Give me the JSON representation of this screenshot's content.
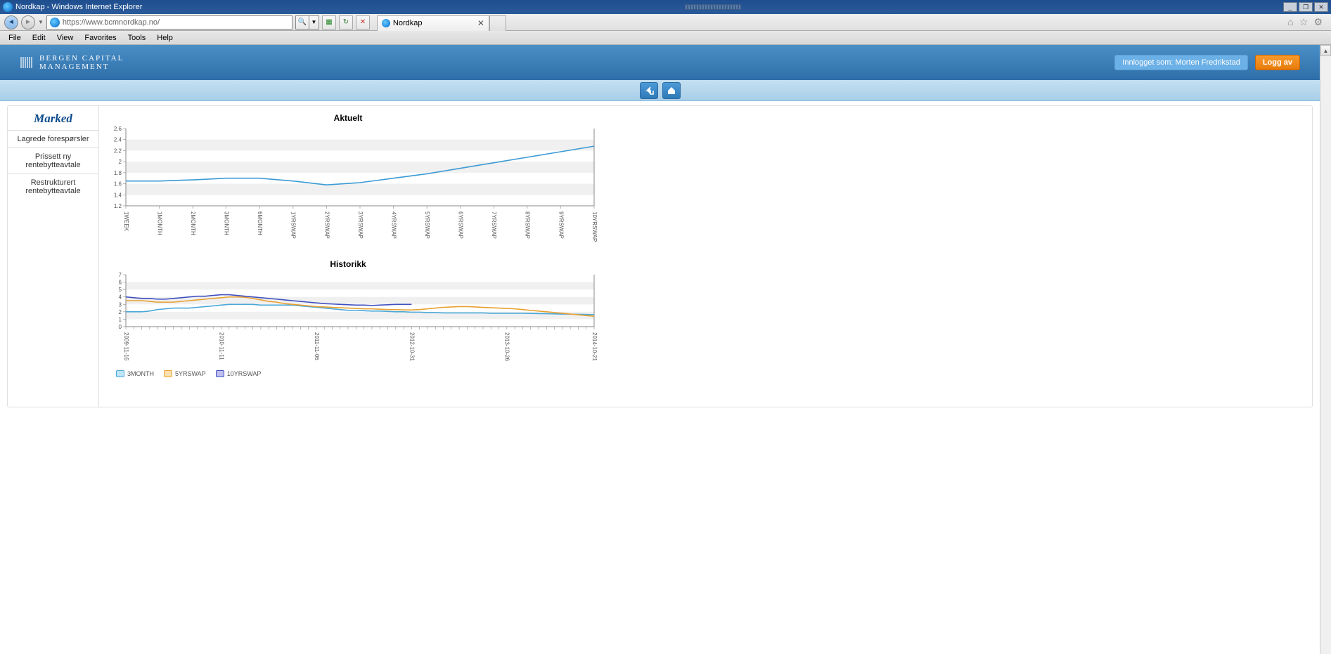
{
  "window": {
    "title": "Nordkap - Windows Internet Explorer"
  },
  "address_bar": {
    "url": "https://www.bcmnordkap.no/"
  },
  "tab": {
    "label": "Nordkap"
  },
  "menubar": {
    "file": "File",
    "edit": "Edit",
    "view": "View",
    "favorites": "Favorites",
    "tools": "Tools",
    "help": "Help"
  },
  "brand": {
    "line1": "BERGEN CAPITAL",
    "line2": "MANAGEMENT"
  },
  "header": {
    "logged_in": "Innlogget som: Morten Fredrikstad",
    "logout": "Logg av"
  },
  "sidebar": {
    "title": "Marked",
    "items": [
      {
        "label": "Lagrede forespørsler"
      },
      {
        "label": "Prissett ny rentebytteavtale"
      },
      {
        "label": "Restrukturert rentebytteavtale"
      }
    ]
  },
  "charts": {
    "aktuelt_title": "Aktuelt",
    "historikk_title": "Historikk"
  },
  "legend": {
    "s1": "3MONTH",
    "s2": "5YRSWAP",
    "s3": "10YRSWAP"
  },
  "chart_data": [
    {
      "type": "line",
      "title": "Aktuelt",
      "xlabel": "",
      "ylabel": "",
      "ylim": [
        1.2,
        2.6
      ],
      "yticks": [
        1.2,
        1.4,
        1.6,
        1.8,
        2.0,
        2.2,
        2.4,
        2.6
      ],
      "categories": [
        "1WEEK",
        "1MONTH",
        "2MONTH",
        "3MONTH",
        "6MONTH",
        "1YRSWAP",
        "2YRSWAP",
        "3YRSWAP",
        "4YRSWAP",
        "5YRSWAP",
        "6YRSWAP",
        "7YRSWAP",
        "8YRSWAP",
        "9YRSWAP",
        "10YRSWAP"
      ],
      "series": [
        {
          "name": "Aktuelt",
          "color": "#3b9bd4",
          "values": [
            1.65,
            1.65,
            1.67,
            1.7,
            1.7,
            1.65,
            1.58,
            1.62,
            1.7,
            1.78,
            1.88,
            1.98,
            2.08,
            2.18,
            2.28
          ]
        }
      ]
    },
    {
      "type": "line",
      "title": "Historikk",
      "xlabel": "",
      "ylabel": "",
      "ylim": [
        0,
        7
      ],
      "yticks": [
        0,
        1,
        2,
        3,
        4,
        5,
        6,
        7
      ],
      "x_ticks_shown": [
        "2009-11-16",
        "2010-11-11",
        "2011-11-06",
        "2012-10-31",
        "2013-10-26",
        "2014-10-21"
      ],
      "x": [
        0,
        1,
        2,
        3,
        4,
        5,
        6,
        7,
        8,
        9,
        10,
        11,
        12,
        13,
        14,
        15,
        16,
        17,
        18,
        19,
        20,
        21,
        22,
        23,
        24,
        25,
        26,
        27,
        28,
        29,
        30,
        31,
        32,
        33,
        34,
        35,
        36,
        37,
        38,
        39,
        40,
        41,
        42,
        43,
        44,
        45,
        46,
        47,
        48,
        49,
        50,
        51,
        52,
        53,
        54,
        55,
        56,
        57,
        58,
        59
      ],
      "series": [
        {
          "name": "3MONTH",
          "color": "#4aa8d8",
          "values": [
            2.0,
            2.0,
            2.0,
            2.1,
            2.3,
            2.4,
            2.5,
            2.5,
            2.5,
            2.6,
            2.7,
            2.8,
            2.9,
            3.0,
            3.0,
            3.0,
            3.0,
            2.9,
            2.9,
            2.9,
            2.9,
            2.9,
            2.8,
            2.7,
            2.6,
            2.5,
            2.4,
            2.3,
            2.2,
            2.2,
            2.15,
            2.1,
            2.1,
            2.05,
            2.0,
            2.0,
            1.95,
            1.95,
            1.9,
            1.9,
            1.85,
            1.85,
            1.85,
            1.85,
            1.85,
            1.85,
            1.8,
            1.8,
            1.8,
            1.8,
            1.8,
            1.78,
            1.76,
            1.74,
            1.72,
            1.7,
            1.68,
            1.66,
            1.64,
            1.62
          ]
        },
        {
          "name": "5YRSWAP",
          "color": "#e8a030",
          "values": [
            3.5,
            3.5,
            3.5,
            3.4,
            3.3,
            3.3,
            3.3,
            3.4,
            3.5,
            3.6,
            3.7,
            3.8,
            3.9,
            4.0,
            4.0,
            3.95,
            3.8,
            3.6,
            3.4,
            3.3,
            3.1,
            3.0,
            2.9,
            2.8,
            2.7,
            2.65,
            2.6,
            2.55,
            2.5,
            2.45,
            2.4,
            2.4,
            2.35,
            2.3,
            2.3,
            2.25,
            2.25,
            2.3,
            2.4,
            2.5,
            2.6,
            2.65,
            2.7,
            2.7,
            2.65,
            2.6,
            2.55,
            2.5,
            2.45,
            2.4,
            2.3,
            2.2,
            2.1,
            2.0,
            1.9,
            1.8,
            1.7,
            1.6,
            1.5,
            1.4
          ]
        },
        {
          "name": "10YRSWAP",
          "color": "#4050c0",
          "values": [
            4.0,
            3.9,
            3.8,
            3.8,
            3.7,
            3.7,
            3.8,
            3.9,
            4.0,
            4.1,
            4.1,
            4.2,
            4.3,
            4.3,
            4.2,
            4.1,
            4.0,
            3.9,
            3.8,
            3.7,
            3.6,
            3.5,
            3.4,
            3.3,
            3.2,
            3.1,
            3.05,
            3.0,
            2.95,
            2.9,
            2.9,
            2.85,
            2.9,
            2.95,
            3.0,
            3.0,
            3.0,
            null,
            null,
            null,
            null,
            null,
            null,
            null,
            null,
            null,
            null,
            null,
            null,
            null,
            null,
            null,
            null,
            null,
            null,
            null,
            null,
            null,
            null,
            null
          ]
        }
      ]
    }
  ]
}
